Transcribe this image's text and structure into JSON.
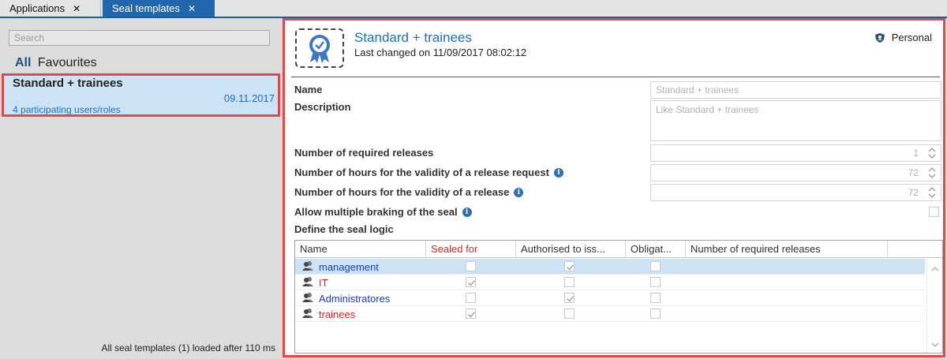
{
  "tabs": [
    {
      "label": "Applications",
      "active": false
    },
    {
      "label": "Seal templates",
      "active": true
    }
  ],
  "left": {
    "search_placeholder": "Search",
    "filters": {
      "all": "All",
      "favourites": "Favourites"
    },
    "templates": [
      {
        "name": "Standard + trainees",
        "date": "09.11.2017",
        "users": "4 participating users/roles"
      }
    ],
    "status": "All seal templates (1) loaded after 110 ms"
  },
  "detail": {
    "title": "Standard + trainees",
    "subtitle": "Last changed on 11/09/2017 08:02:12",
    "scope": "Personal",
    "labels": {
      "name": "Name",
      "description": "Description",
      "required_releases": "Number of required releases",
      "hours_request": "Number of hours for the validity of a release request",
      "hours_release": "Number of hours for the validity of a release",
      "allow_multiple": "Allow multiple braking of the seal",
      "seal_logic": "Define the seal logic"
    },
    "name_placeholder": "Standard + trainees",
    "description_placeholder": "Like Standard + trainees",
    "required_releases": "1",
    "hours_request": "72",
    "hours_release": "72",
    "allow_multiple_checked": false
  },
  "grid": {
    "columns": [
      "Name",
      "Sealed for",
      "Authorised to iss...",
      "Obligat...",
      "Number of required releases"
    ],
    "sealed_for_color": "#e02020",
    "rows": [
      {
        "name": "management",
        "name_color": "#1a3fb8",
        "sealed_for": false,
        "authorised": true,
        "obligatory": false,
        "selected": true
      },
      {
        "name": "IT",
        "name_color": "#e02020",
        "sealed_for": true,
        "authorised": false,
        "obligatory": false,
        "selected": false
      },
      {
        "name": "Administratores",
        "name_color": "#1a3fb8",
        "sealed_for": false,
        "authorised": true,
        "obligatory": false,
        "selected": false
      },
      {
        "name": "trainees",
        "name_color": "#e02020",
        "sealed_for": true,
        "authorised": false,
        "obligatory": false,
        "selected": false
      }
    ]
  }
}
